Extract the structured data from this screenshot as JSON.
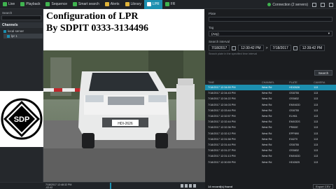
{
  "menu": [
    {
      "label": "Live",
      "icon": "live-icon",
      "color": "#3fb34f"
    },
    {
      "label": "Playback",
      "icon": "playback-icon",
      "color": "#3fb34f"
    },
    {
      "label": "Sequence",
      "icon": "sequence-icon",
      "color": "#3fb34f"
    },
    {
      "label": "Smart search",
      "icon": "smart-search-icon",
      "color": "#3fb34f"
    },
    {
      "label": "Alerts",
      "icon": "alerts-icon",
      "color": "#e0b33a"
    },
    {
      "label": "Library",
      "icon": "library-icon",
      "color": "#e0b33a"
    },
    {
      "label": "LPR",
      "icon": "lpr-icon",
      "color": "#ffffff"
    },
    {
      "label": "FR",
      "icon": "fr-icon",
      "color": "#3fb34f"
    }
  ],
  "connection_label": "Connection (2 servers)",
  "left_panel": {
    "search_label": "Search",
    "channels_label": "Channels",
    "tree": [
      "local server",
      "lpr 1"
    ]
  },
  "title": {
    "line1": "Configuration of LPR",
    "line2": "By SDPIT 0333-3134496"
  },
  "logo_text": "SDP",
  "vehicle_plate": "HDI-2626",
  "filters": {
    "plate_label": "Plate",
    "plate_value": "",
    "tag_label": "Tag",
    "tag_value": "(Any)",
    "interval_label": "Search interval",
    "from_date": "7/18/2017",
    "from_time": "12:30:42 PM",
    "to_date": "7/18/2017",
    "to_time": "12:39:42 PM",
    "hint": "Search plate in the specified time interval",
    "search_button": "Search"
  },
  "results": {
    "headers": [
      "TIME",
      "CHANNEL",
      "PLATE",
      "CAMERA"
    ],
    "rows": [
      [
        "7/18/2017 12:34:59 PM",
        "West Rd",
        "HDI2626",
        "113"
      ],
      [
        "7/18/2017 12:34:43 PM",
        "West Rd",
        "GS8755",
        "113"
      ],
      [
        "7/18/2017 12:34:22 PM",
        "West Rd",
        "GS5832",
        "113"
      ],
      [
        "7/18/2017 12:34:03 PM",
        "West Rd",
        "EMX4DD",
        "113"
      ],
      [
        "7/18/2017 12:33:44 PM",
        "West Rd",
        "GS8755",
        "113"
      ],
      [
        "7/18/2017 12:32:57 PM",
        "West Rd",
        "ELH61",
        "113"
      ],
      [
        "7/18/2017 12:32:44 PM",
        "West Rd",
        "EMX2DS",
        "113"
      ],
      [
        "7/18/2017 12:32:36 PM",
        "West Rd",
        "PR8DE",
        "113"
      ],
      [
        "7/18/2017 12:32:12 PM",
        "West Rd",
        "EPP890",
        "113"
      ],
      [
        "7/18/2017 12:31:58 PM",
        "West Rd",
        "EI4270",
        "113"
      ],
      [
        "7/18/2017 12:31:44 PM",
        "West Rd",
        "GS8755",
        "113"
      ],
      [
        "7/18/2017 12:31:27 PM",
        "West Rd",
        "GS5832",
        "113"
      ],
      [
        "7/18/2017 12:31:13 PM",
        "West Rd",
        "EMX4DD",
        "113"
      ],
      [
        "7/18/2017 12:30:59 PM",
        "West Rd",
        "HDI2825",
        "113"
      ]
    ],
    "selected_index": 0,
    "count_label": "14 record(s) found",
    "export_label": "Export CSV"
  },
  "timeline": {
    "date": "7/18/2017",
    "time": "12:48:32 PM",
    "sub": "-02:42"
  }
}
